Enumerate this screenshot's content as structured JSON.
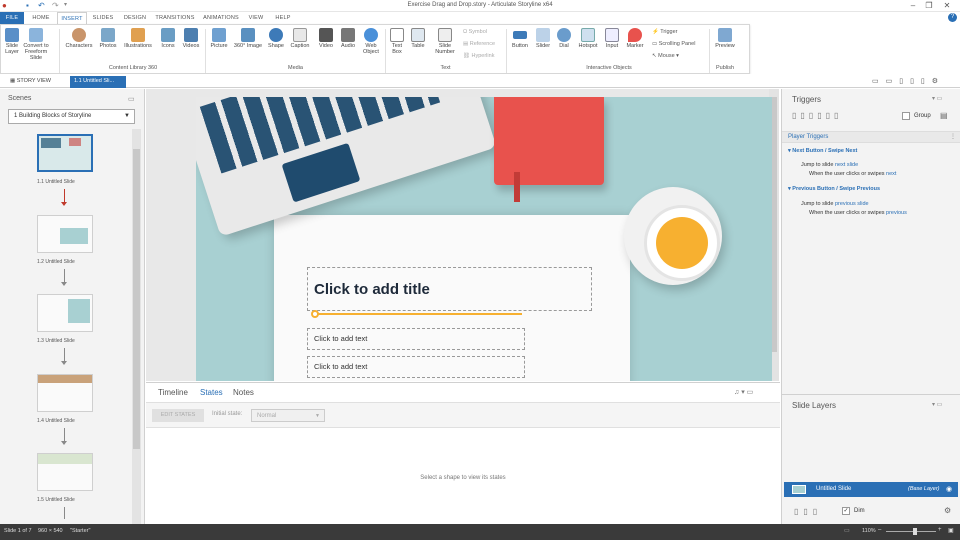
{
  "window": {
    "title": "Exercise Drag and Drop.story - Articulate Storyline x64"
  },
  "tabs": [
    {
      "label": "FILE"
    },
    {
      "label": "HOME"
    },
    {
      "label": "INSERT"
    },
    {
      "label": "SLIDES"
    },
    {
      "label": "DESIGN"
    },
    {
      "label": "TRANSITIONS"
    },
    {
      "label": "ANIMATIONS"
    },
    {
      "label": "VIEW"
    },
    {
      "label": "HELP"
    }
  ],
  "ribbon": {
    "slide_layer": "Slide Layer",
    "convert_freeform": "Convert to Freeform Slide",
    "characters": "Characters",
    "photos": "Photos",
    "illustrations": "Illustrations",
    "icons": "Icons",
    "videos": "Videos",
    "content_library": "Content Library 360",
    "picture": "Picture",
    "image360": "360° Image",
    "shape": "Shape",
    "caption": "Caption",
    "video": "Video",
    "audio": "Audio",
    "web_object": "Web Object",
    "media": "Media",
    "text_box": "Text Box",
    "table": "Table",
    "slide_number": "Slide Number",
    "symbol": "Symbol",
    "reference": "Reference",
    "hyperlink": "Hyperlink",
    "text": "Text",
    "button": "Button",
    "slider": "Slider",
    "dial": "Dial",
    "hotspot": "Hotspot",
    "input": "Input",
    "marker": "Marker",
    "trigger": "Trigger",
    "scrolling_panel": "Scrolling Panel",
    "mouse": "Mouse",
    "interactive_objects": "Interactive Objects",
    "preview": "Preview",
    "publish": "Publish"
  },
  "viewtabs": {
    "story": "STORY VIEW",
    "slide": "1.1 Untitled Sli..."
  },
  "scenes": {
    "title": "Scenes",
    "dropdown": "1 Building Blocks of Storyline",
    "slides": [
      "1.1 Untitled Slide",
      "1.2 Untitled Slide",
      "1.3 Untitled Slide",
      "1.4 Untitled Slide",
      "1.5 Untitled Slide"
    ]
  },
  "slide": {
    "title_placeholder": "Click to add title",
    "text1": "Click to add text",
    "text2": "Click to add text"
  },
  "bottom": {
    "tabs": [
      "Timeline",
      "States",
      "Notes"
    ],
    "edit_states": "EDIT STATES",
    "initial_state_label": "Initial state:",
    "initial_state_value": "Normal",
    "empty_msg": "Select a shape to view its states"
  },
  "triggers": {
    "title": "Triggers",
    "group": "Group",
    "player_triggers": "Player Triggers",
    "items": [
      {
        "header": "Next Button / Swipe Next",
        "action": "Jump to slide",
        "action_target": "next slide",
        "cond": "When the user clicks or swipes",
        "cond_target": "next"
      },
      {
        "header": "Previous Button / Swipe Previous",
        "action": "Jump to slide",
        "action_target": "previous slide",
        "cond": "When the user clicks or swipes",
        "cond_target": "previous"
      }
    ]
  },
  "layers": {
    "title": "Slide Layers",
    "base_name": "Untitled Slide",
    "base_tag": "(Base Layer)",
    "dim": "Dim"
  },
  "status": {
    "slide_of": "Slide 1 of 7",
    "size": "960 × 540",
    "theme": "\"Starter\"",
    "zoom": "110%"
  },
  "colors": {
    "accent": "#2a6fb5",
    "book": "#e8524d",
    "cup": "#f7b030",
    "keys": "#1f4b6e"
  }
}
